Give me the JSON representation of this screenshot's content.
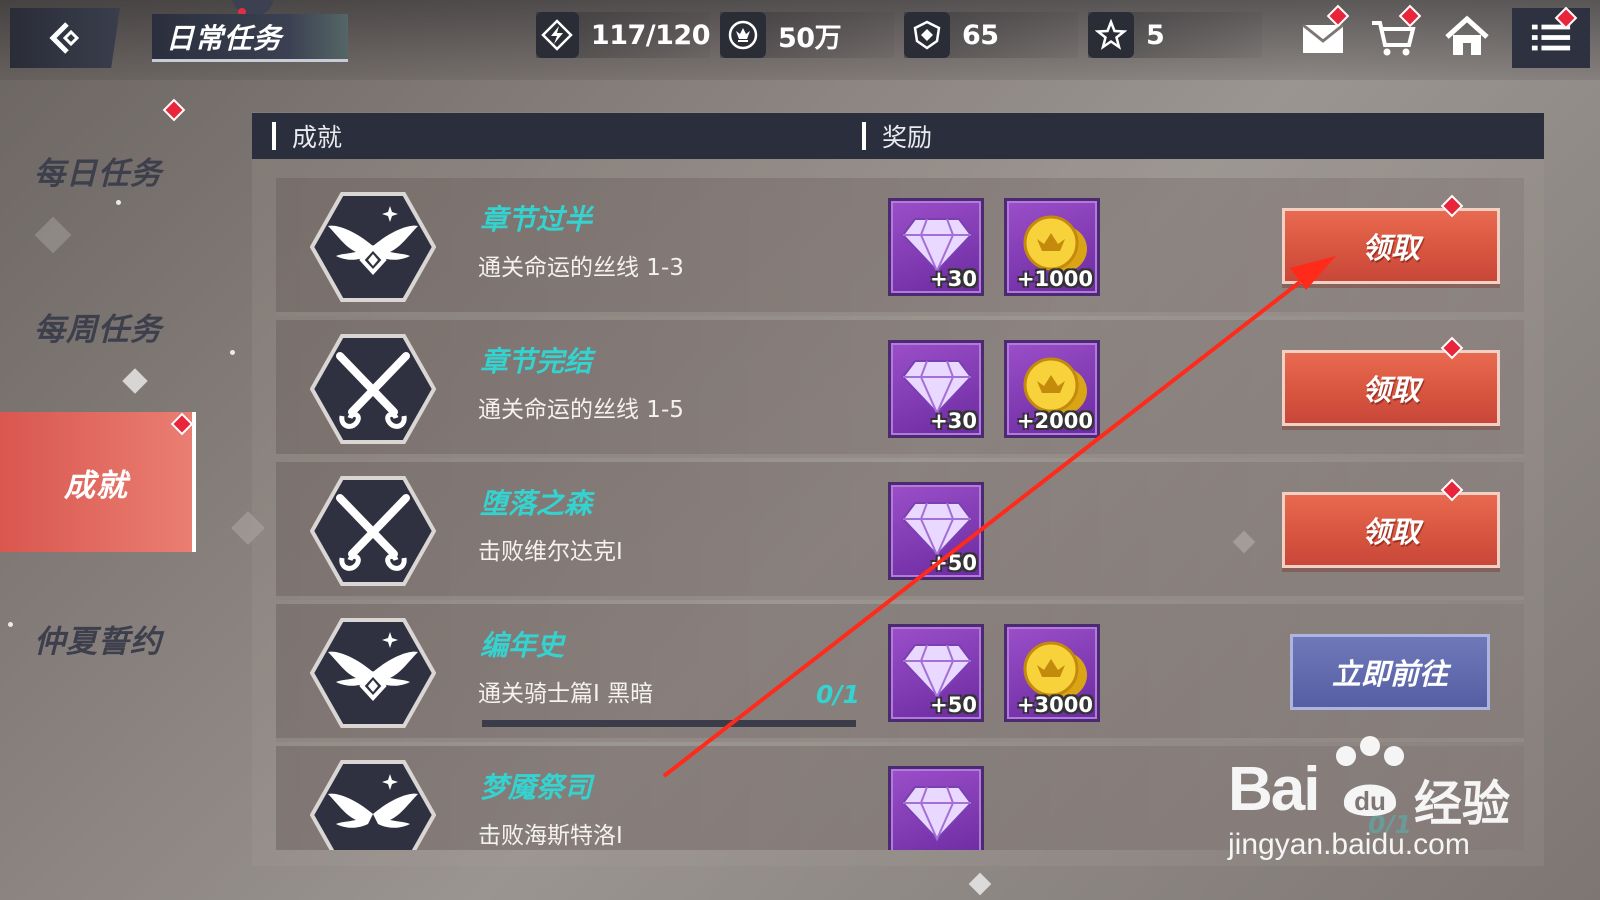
{
  "header": {
    "title": "日常任务",
    "resources": [
      {
        "icon": "stamina-icon",
        "value": "117/120"
      },
      {
        "icon": "coin-icon",
        "value": "50万"
      },
      {
        "icon": "shield-currency-icon",
        "value": "65"
      },
      {
        "icon": "star-icon",
        "value": "5"
      }
    ]
  },
  "sidebar": {
    "items": [
      {
        "label": "每日任务",
        "active": false
      },
      {
        "label": "每周任务",
        "active": false
      },
      {
        "label": "成就",
        "active": true
      },
      {
        "label": "仲夏誓约",
        "active": false
      }
    ]
  },
  "table": {
    "columns": [
      "成就",
      "奖励"
    ]
  },
  "achievements": [
    {
      "name": "章节过半",
      "desc": "通关命运的丝线 1-3",
      "badge": "wings-icon",
      "rewards": [
        {
          "type": "diamond",
          "amount": "+30"
        },
        {
          "type": "coin",
          "amount": "+1000"
        }
      ],
      "action": "领取",
      "action_type": "claim"
    },
    {
      "name": "章节完结",
      "desc": "通关命运的丝线 1-5",
      "badge": "crossed-swords-icon",
      "rewards": [
        {
          "type": "diamond",
          "amount": "+30"
        },
        {
          "type": "coin",
          "amount": "+2000"
        }
      ],
      "action": "领取",
      "action_type": "claim"
    },
    {
      "name": "堕落之森",
      "desc": "击败维尔达克Ⅰ",
      "badge": "crossed-swords-icon",
      "rewards": [
        {
          "type": "diamond",
          "amount": "+50"
        }
      ],
      "action": "领取",
      "action_type": "claim"
    },
    {
      "name": "编年史",
      "desc": "通关骑士篇Ⅰ  黑暗",
      "badge": "wings-icon",
      "progress": "0/1",
      "progress_fraction": 0.0,
      "rewards": [
        {
          "type": "diamond",
          "amount": "+50"
        },
        {
          "type": "coin",
          "amount": "+3000"
        }
      ],
      "action": "立即前往",
      "action_type": "go"
    },
    {
      "name": "梦魇祭司",
      "desc": "击败海斯特洛Ⅰ",
      "badge": "wings-icon",
      "rewards": [
        {
          "type": "diamond",
          "amount": ""
        }
      ],
      "action": "",
      "action_type": "none"
    }
  ],
  "watermark": {
    "logo": "Bai",
    "du": "du",
    "jingyan": "经验",
    "url": "jingyan.baidu.com",
    "ghost_progress": "0/1"
  },
  "colors": {
    "accent_cyan": "#34d3d0",
    "claim_button": "#d8553f",
    "go_button": "#555ea3",
    "active_tab": "#d9574f",
    "notification": "#e8253a",
    "annotation_arrow": "#ff2a1a"
  }
}
